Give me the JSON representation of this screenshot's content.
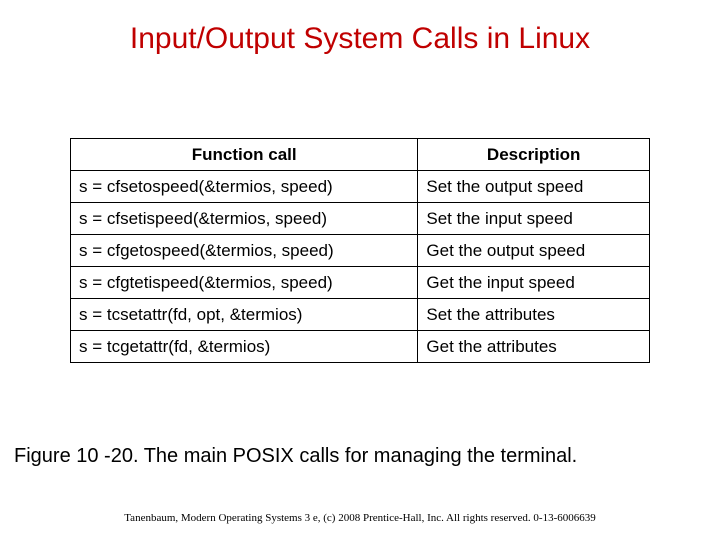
{
  "title": "Input/Output System Calls in Linux",
  "table": {
    "headers": {
      "func": "Function call",
      "desc": "Description"
    },
    "rows": [
      {
        "func": "s = cfsetospeed(&termios, speed)",
        "desc": "Set the output speed"
      },
      {
        "func": "s = cfsetispeed(&termios, speed)",
        "desc": "Set the input speed"
      },
      {
        "func": "s = cfgetospeed(&termios, speed)",
        "desc": "Get the output speed"
      },
      {
        "func": "s = cfgtetispeed(&termios, speed)",
        "desc": "Get the input speed"
      },
      {
        "func": "s = tcsetattr(fd, opt, &termios)",
        "desc": "Set the attributes"
      },
      {
        "func": "s = tcgetattr(fd, &termios)",
        "desc": "Get the attributes"
      }
    ]
  },
  "caption": "Figure 10 -20. The main POSIX calls for managing the terminal.",
  "footer": "Tanenbaum, Modern Operating Systems 3 e, (c) 2008 Prentice-Hall, Inc. All rights reserved. 0-13-6006639"
}
